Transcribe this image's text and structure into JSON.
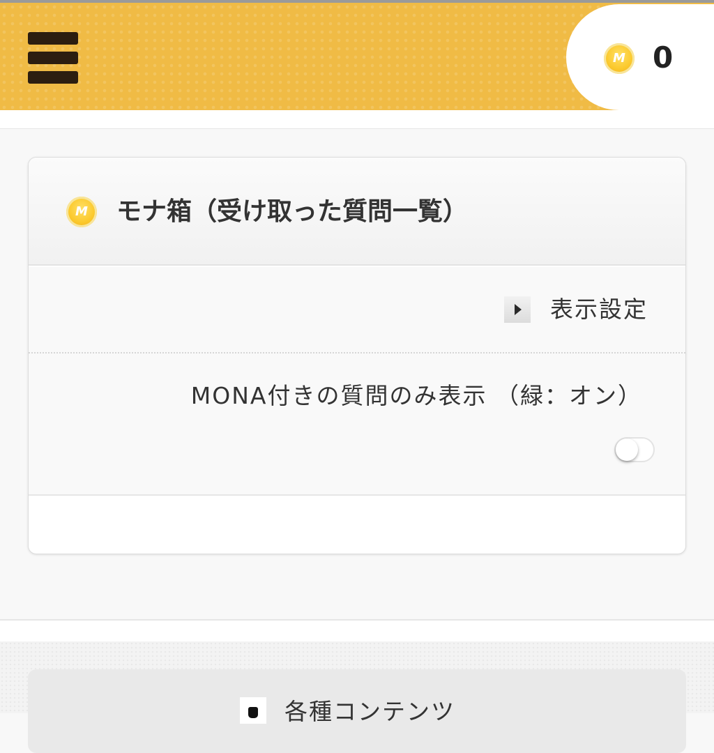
{
  "header": {
    "menu_icon": "hamburger-menu-icon",
    "coin_icon": "mona-coin-icon",
    "balance": "0"
  },
  "card": {
    "title_icon": "mona-coin-icon",
    "title": "モナ箱（受け取った質問一覧）",
    "settings_icon": "triangle-right-icon",
    "settings_label": "表示設定",
    "filter_label": "MONA付きの質問のみ表示 （緑：オン）",
    "filter_on": false
  },
  "footer": {
    "contents_icon": "cat-icon",
    "contents_label": "各種コンテンツ"
  }
}
